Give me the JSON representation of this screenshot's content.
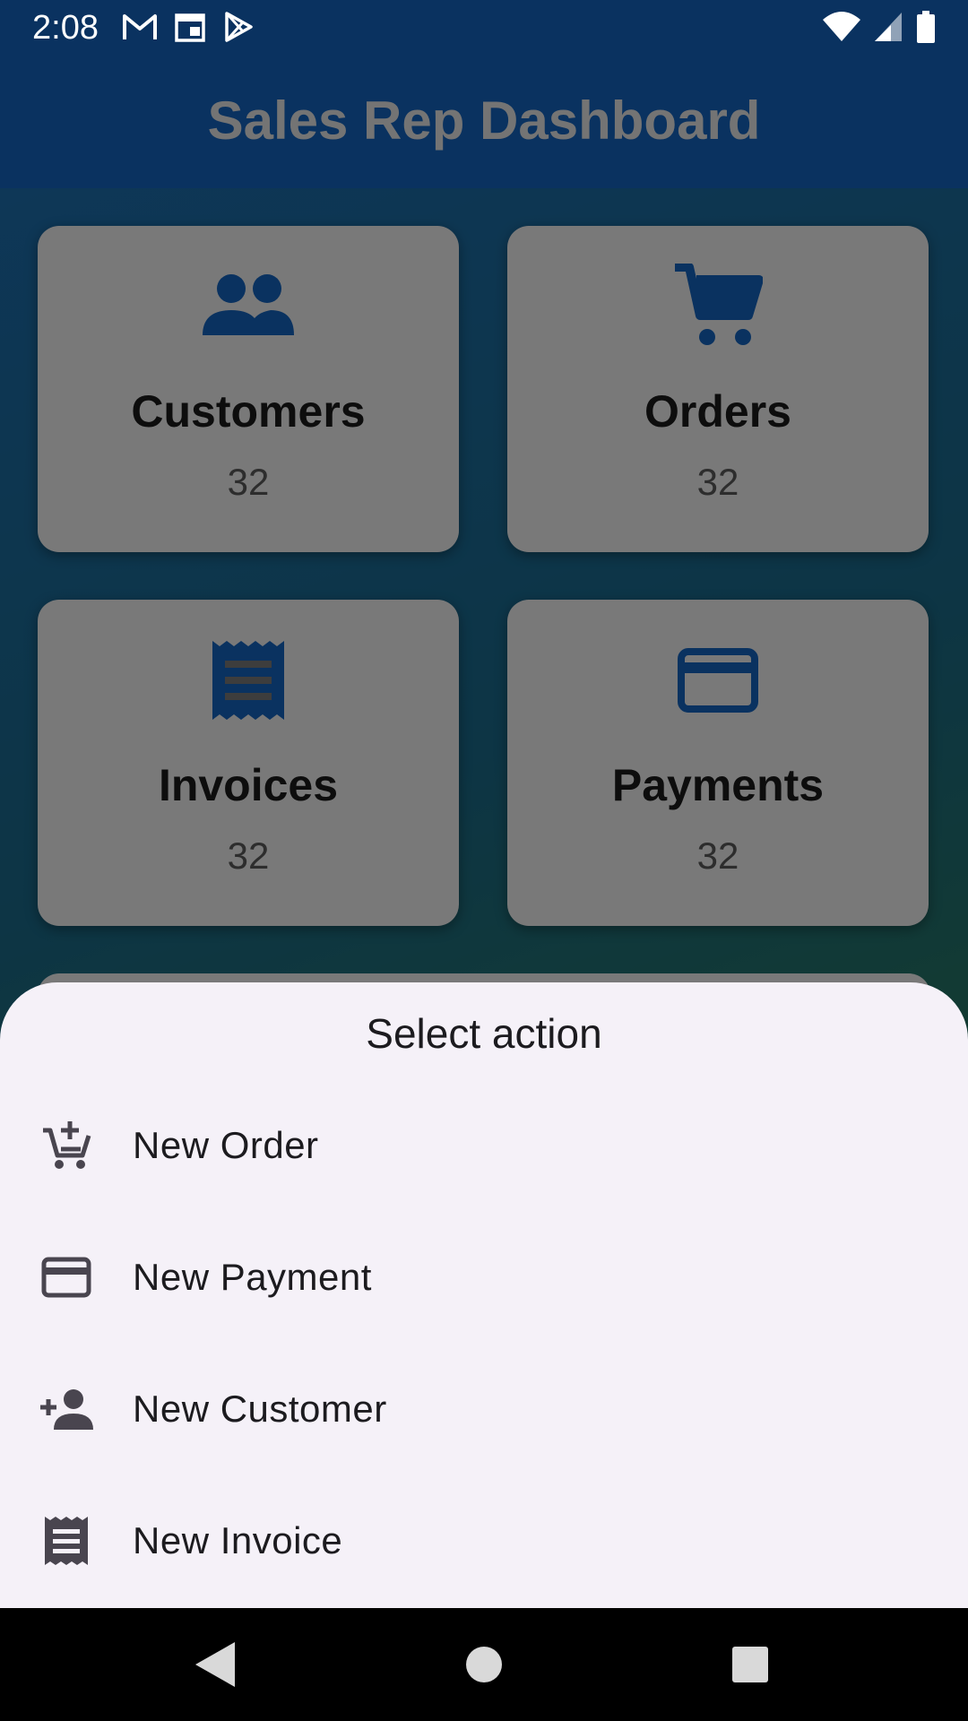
{
  "status_bar": {
    "time": "2:08",
    "notification_icons": [
      "gmail-icon",
      "calendar-icon",
      "play-store-icon"
    ],
    "system_icons": [
      "wifi-icon",
      "signal-icon",
      "battery-icon"
    ]
  },
  "app": {
    "title": "Sales Rep Dashboard",
    "accent": "#1565c0"
  },
  "dashboard": {
    "cards": [
      {
        "label": "Customers",
        "count": "32",
        "icon": "people-icon"
      },
      {
        "label": "Orders",
        "count": "32",
        "icon": "shopping-cart-icon"
      },
      {
        "label": "Invoices",
        "count": "32",
        "icon": "receipt-icon"
      },
      {
        "label": "Payments",
        "count": "32",
        "icon": "credit-card-icon"
      }
    ]
  },
  "sheet": {
    "title": "Select action",
    "items": [
      {
        "label": "New Order",
        "icon": "add-shopping-cart-icon"
      },
      {
        "label": "New Payment",
        "icon": "credit-card-icon"
      },
      {
        "label": "New Customer",
        "icon": "person-add-icon"
      },
      {
        "label": "New Invoice",
        "icon": "receipt-icon"
      }
    ]
  },
  "navigation": {
    "buttons": [
      "back-icon",
      "home-icon",
      "recents-icon"
    ]
  }
}
